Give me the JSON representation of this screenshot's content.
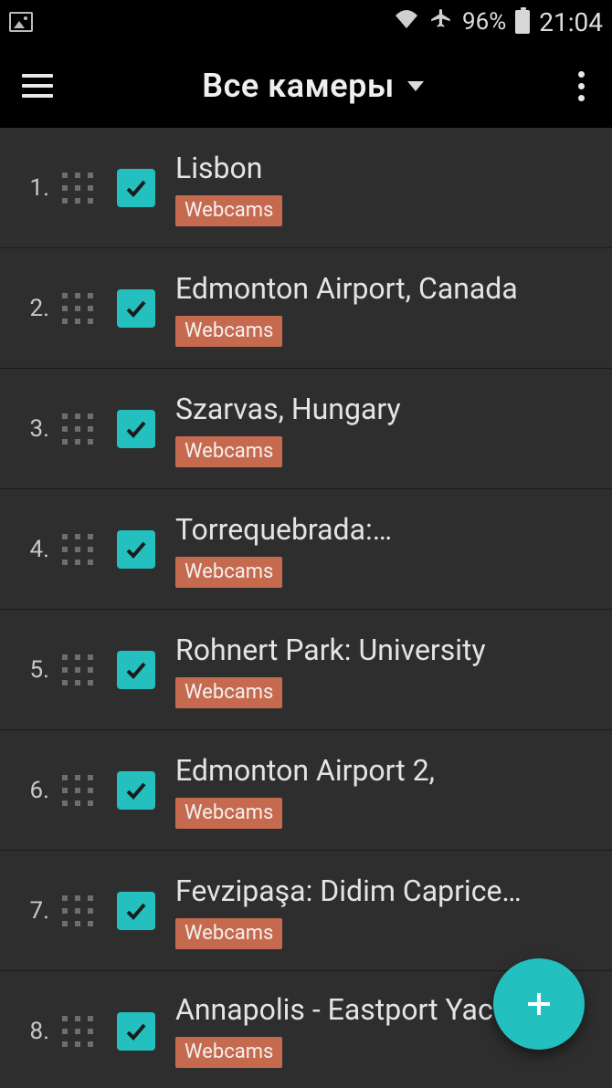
{
  "status": {
    "battery_pct": "96%",
    "time": "21:04"
  },
  "header": {
    "title": "Все камеры"
  },
  "items": [
    {
      "num": "1.",
      "label": "Lisbon",
      "tag": "Webcams",
      "checked": true
    },
    {
      "num": "2.",
      "label": "Edmonton Airport, Canada",
      "tag": "Webcams",
      "checked": true
    },
    {
      "num": "3.",
      "label": "Szarvas, Hungary",
      "tag": "Webcams",
      "checked": true
    },
    {
      "num": "4.",
      "label": "Torrequebrada:…",
      "tag": "Webcams",
      "checked": true
    },
    {
      "num": "5.",
      "label": "Rohnert Park: University",
      "tag": "Webcams",
      "checked": true
    },
    {
      "num": "6.",
      "label": "Edmonton Airport 2,",
      "tag": "Webcams",
      "checked": true
    },
    {
      "num": "7.",
      "label": "Fevzipaşa: Didim Caprice…",
      "tag": "Webcams",
      "checked": true
    },
    {
      "num": "8.",
      "label": "Annapolis - Eastport Yac",
      "tag": "Webcams",
      "checked": true
    }
  ]
}
